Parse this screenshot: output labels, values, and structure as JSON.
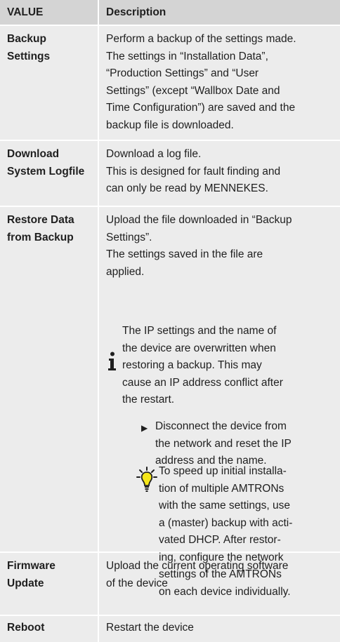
{
  "header": {
    "col1": "VALUE",
    "col2": "Description"
  },
  "rows": [
    {
      "key_lines": [
        "Backup",
        "Settings"
      ],
      "desc_lines": [
        "Perform a backup of the settings made.",
        "The settings in “Installation Data”,",
        "“Production Settings” and “User",
        "Settings” (except “Wallbox Date and",
        "Time Configuration”) are saved and the",
        "backup file is downloaded."
      ]
    },
    {
      "key_lines": [
        "Download",
        "System Logfile"
      ],
      "desc_lines": [
        "Download a log file.",
        "This is designed for fault finding and",
        "can only be read by MENNEKES."
      ]
    },
    {
      "key_lines": [
        "Restore Data",
        "from Backup"
      ],
      "desc_lines": [
        "Upload the file downloaded in “Backup",
        "Settings”.",
        "The settings saved in the file are",
        "applied."
      ],
      "note": {
        "icon": "info-icon",
        "lines": [
          "The IP settings and the name of",
          "the device are overwritten when",
          "restoring a backup. This may",
          "cause an IP address conflict after",
          "the restart."
        ],
        "bullet_icon": "triangle-bullet-icon",
        "bullet_lines": [
          "Disconnect the device from",
          "the network and reset the IP",
          "address and the name."
        ],
        "tip_icon": "lightbulb-icon",
        "tip_lines": [
          "To speed up initial installa-",
          "tion of multiple AMTRONs",
          "with the same settings, use",
          "a (master) backup with acti-",
          "vated DHCP. After restor-",
          "ing, configure the network",
          "settings of the AMTRONs",
          "on each device individually."
        ]
      }
    },
    {
      "key_lines": [
        "Firmware",
        "Update"
      ],
      "desc_lines": [
        "Upload the current operating software",
        "of the device"
      ]
    },
    {
      "key_lines": [
        "Reboot"
      ],
      "desc_lines": [
        "Restart the device"
      ]
    }
  ],
  "colors": {
    "header_bg": "#d4d4d4",
    "row_bg": "#ececec",
    "tip_icon": "#f5e619"
  }
}
